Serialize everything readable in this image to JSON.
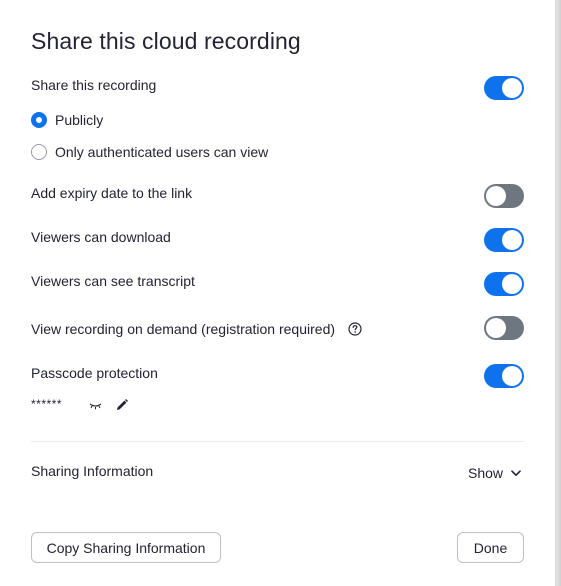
{
  "dialog": {
    "title": "Share this cloud recording"
  },
  "settings": {
    "share_recording": {
      "label": "Share this recording",
      "enabled": true
    },
    "audience": {
      "options": [
        {
          "label": "Publicly",
          "selected": true
        },
        {
          "label": "Only authenticated users can view",
          "selected": false
        }
      ]
    },
    "expiry_date": {
      "label": "Add expiry date to the link",
      "enabled": false
    },
    "viewers_download": {
      "label": "Viewers can download",
      "enabled": true
    },
    "viewers_transcript": {
      "label": "Viewers can see transcript",
      "enabled": true
    },
    "on_demand": {
      "label": "View recording on demand (registration required)",
      "enabled": false,
      "help_icon": "question-circle-icon"
    },
    "passcode": {
      "label": "Passcode protection",
      "enabled": true,
      "masked_value": "******",
      "reveal_icon": "eye-closed-icon",
      "edit_icon": "pencil-icon"
    }
  },
  "sharing_information": {
    "label": "Sharing Information",
    "toggle_label": "Show",
    "toggle_icon": "chevron-down-icon"
  },
  "footer": {
    "copy_label": "Copy Sharing Information",
    "done_label": "Done"
  },
  "colors": {
    "accent": "#0e72ed",
    "toggle_off": "#6e7680",
    "text": "#232333"
  }
}
